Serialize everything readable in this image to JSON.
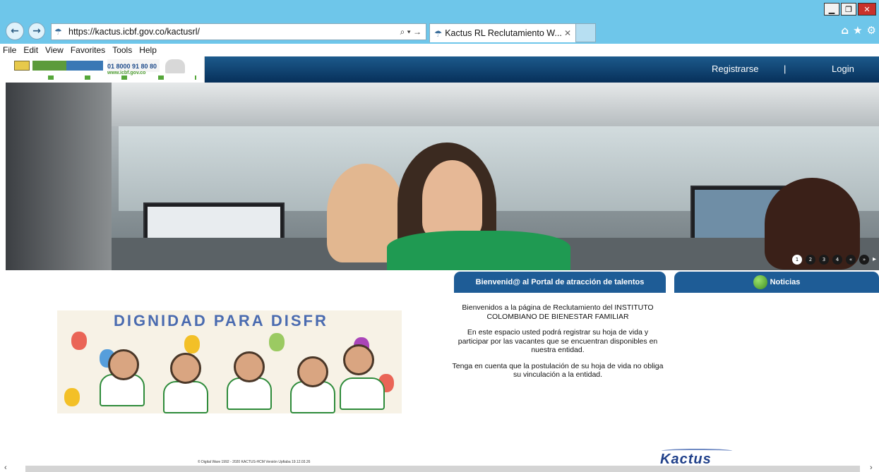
{
  "browser": {
    "url": "https://kactus.icbf.gov.co/kactusrl/",
    "search_glyph": "⌕ ▾ →",
    "tab_title": "Kactus RL Reclutamiento W...",
    "tab_close": "✕",
    "menu": [
      "File",
      "Edit",
      "View",
      "Favorites",
      "Tools",
      "Help"
    ],
    "window_controls": {
      "minimize": "▁",
      "restore": "❐",
      "close": "✕"
    },
    "tools_glyphs": [
      "⌂",
      "★",
      "⚙"
    ],
    "back": "←",
    "forward": "→"
  },
  "header": {
    "logo": {
      "phone": "01 8000 91 80 80",
      "web": "www.icbf.gov.co"
    },
    "links": {
      "register": "Registrarse",
      "separator": "|",
      "login": "Login"
    }
  },
  "carousel": {
    "dots": [
      "1",
      "2",
      "3",
      "4",
      "«",
      "»"
    ],
    "next": "▸",
    "active_index": 0
  },
  "welcome": {
    "title": "Bienvenid@ al Portal de atracción de talentos",
    "p1": "Bienvenidos a la página de Reclutamiento del INSTITUTO COLOMBIANO DE BIENESTAR FAMILIAR",
    "p2": "En este espacio usted podrá registrar su hoja de vida y participar por las vacantes que se encuentran disponibles en nuestra entidad.",
    "p3": "Tenga en cuenta que la postulación de su hoja de vida no obliga su vinculación a la entidad."
  },
  "news": {
    "title": "Noticias"
  },
  "kids_image": {
    "banner_text": "DIGNIDAD PARA DISFR"
  },
  "footer": {
    "copyright": "© Digital Ware 1992 - 2020 KACTUS-HCM Versión Upfiaba 19.12.03.26",
    "brand": "Kactus"
  },
  "colors": {
    "titlebar": "#6ec6ea",
    "header_dark": "#07305a",
    "panel_blue": "#1e5c96"
  }
}
